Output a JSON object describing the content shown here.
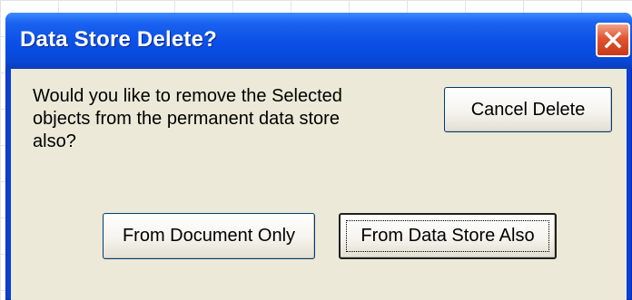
{
  "dialog": {
    "title": "Data Store Delete?",
    "close_icon": "close-icon",
    "message": "Would you like to remove the Selected\nobjects from the permanent data store\nalso?"
  },
  "buttons": {
    "cancel_label": "Cancel Delete",
    "document_only_label": "From Document Only",
    "data_store_also_label": "From Data Store Also"
  },
  "colors": {
    "title_bar": "#0a4fe6",
    "client_background": "#ece9d8",
    "close_button": "#e1542e"
  }
}
